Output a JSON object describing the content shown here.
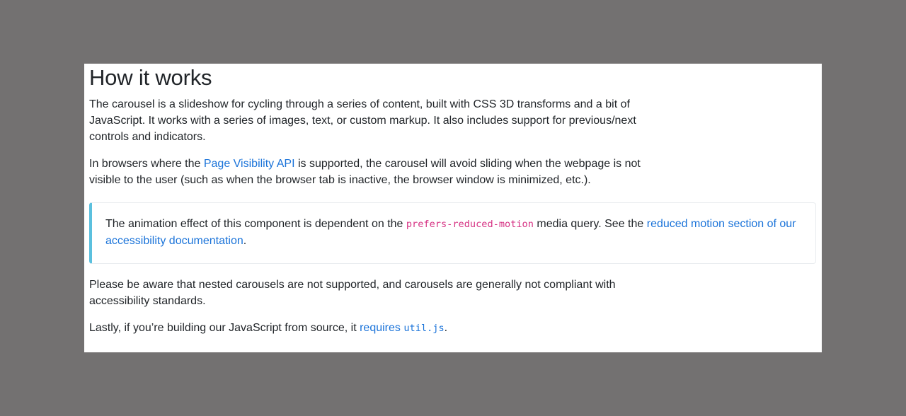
{
  "section": {
    "title": "How it works"
  },
  "intro": {
    "text": "The carousel is a slideshow for cycling through a series of content, built with CSS 3D transforms and a bit of JavaScript. It works with a series of images, text, or custom markup. It also includes support for previous/next controls and indicators."
  },
  "visibility": {
    "before": "In browsers where the ",
    "link": "Page Visibility API",
    "after": " is supported, the carousel will avoid sliding when the webpage is not visible to the user (such as when the browser tab is inactive, the browser window is minimized, etc.)."
  },
  "callout": {
    "before": "The animation effect of this component is dependent on the ",
    "code": "prefers-reduced-motion",
    "middle": " media query. See the ",
    "link": "reduced motion section of our accessibility documentation",
    "after": "."
  },
  "nested": {
    "text": "Please be aware that nested carousels are not supported, and carousels are generally not compliant with accessibility standards."
  },
  "lastly": {
    "before": "Lastly, if you’re building our JavaScript from source, it ",
    "link": "requires",
    "code": "util.js",
    "after": "."
  },
  "colors": {
    "background": "#737171",
    "link": "#1a73d9",
    "code_pink": "#d63384",
    "callout_border": "#5bc0de",
    "text": "#212529"
  }
}
